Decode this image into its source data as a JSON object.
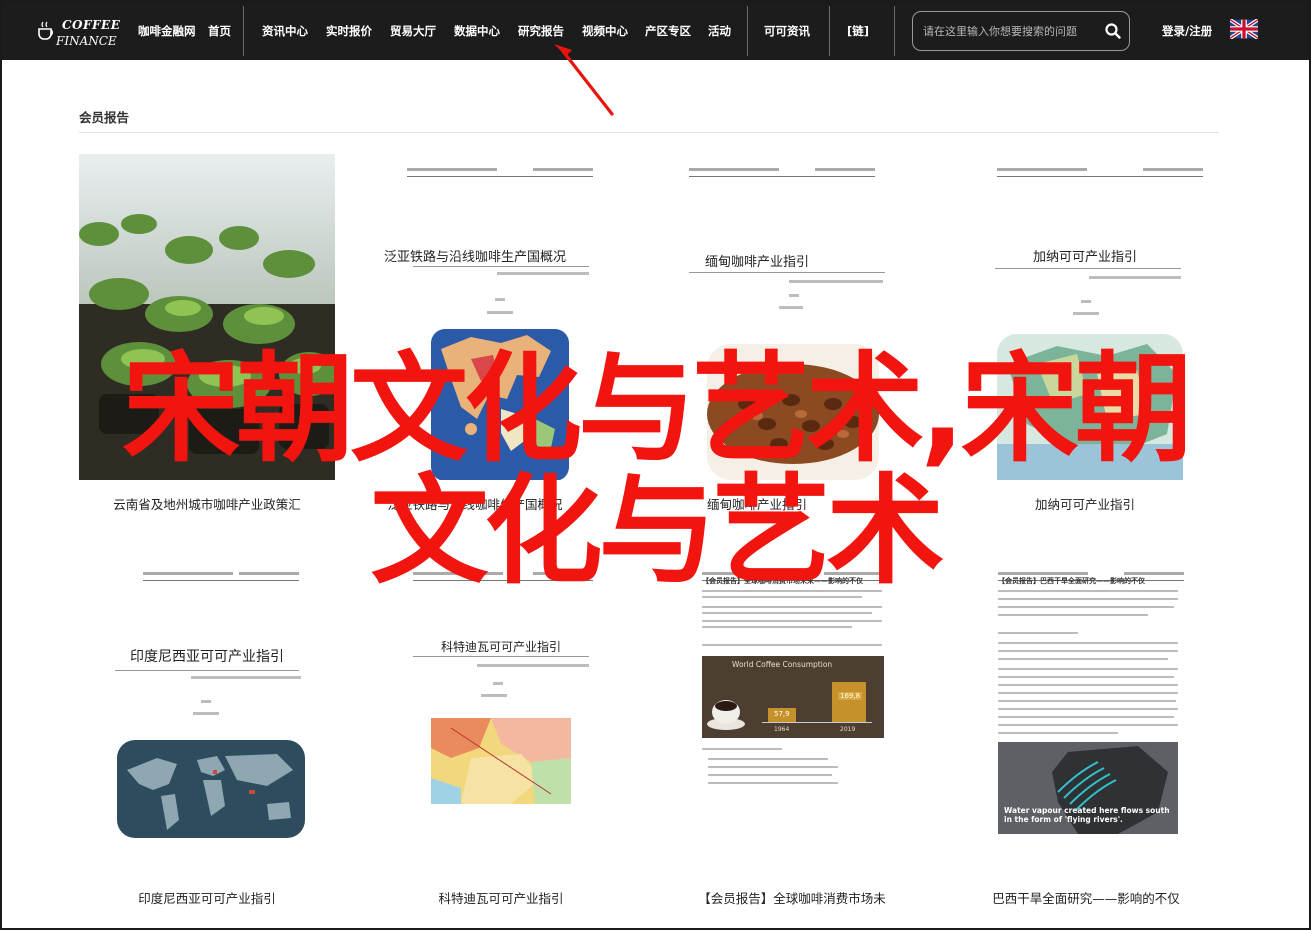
{
  "brand": {
    "line1": "COFFEE",
    "line2": "FINANCE"
  },
  "nav": {
    "items": [
      "咖啡金融网",
      "首页",
      "资讯中心",
      "实时报价",
      "贸易大厅",
      "数据中心",
      "研究报告",
      "视频中心",
      "产区专区",
      "活动",
      "可可资讯",
      "[链]"
    ],
    "search_placeholder": "请在这里输入你想要搜索的问题",
    "login": "登录/注册"
  },
  "section": {
    "title": "会员报告"
  },
  "cards": [
    {
      "caption": "云南省及地州城市咖啡产业政策汇",
      "doc_title": ""
    },
    {
      "caption": "泛亚铁路与沿线咖啡生产国概况",
      "doc_title": "泛亚铁路与沿线咖啡生产国概况"
    },
    {
      "caption": "缅甸咖啡产业指引",
      "doc_title": "缅甸咖啡产业指引"
    },
    {
      "caption": "加纳可可产业指引",
      "doc_title": "加纳可可产业指引"
    },
    {
      "caption": "印度尼西亚可可产业指引",
      "doc_title": "印度尼西亚可可产业指引"
    },
    {
      "caption": "科特迪瓦可可产业指引",
      "doc_title": "科特迪瓦可可产业指引"
    },
    {
      "caption": "【会员报告】全球咖啡消费市场未",
      "doc_title": "【会员报告】全球咖啡消费市场未来——影响的不仅"
    },
    {
      "caption": "巴西干旱全面研究——影响的不仅",
      "doc_title": "【会员报告】巴西干旱全面研究——影响的不仅"
    }
  ],
  "coffee_chart": {
    "title": "World Coffee Consumption",
    "bars": [
      {
        "year": "1964",
        "value": "57,9"
      },
      {
        "year": "2019",
        "value": "169,8"
      }
    ]
  },
  "brazil_map_caption": "Water vapour created here flows south in the form of 'flying rivers'.",
  "overlay": {
    "line1": "宋朝文化与艺术,宋朝",
    "line2": "文化与艺术"
  },
  "colors": {
    "nav_bg": "#1c1c1c",
    "overlay_red": "#f1140f",
    "arrow_red": "#e8140e"
  }
}
